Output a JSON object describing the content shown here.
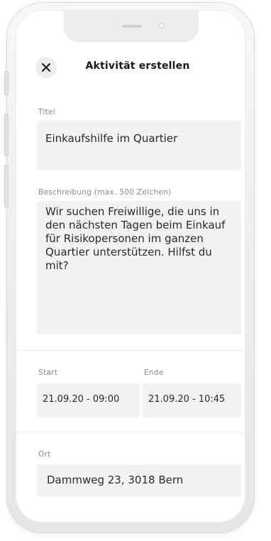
{
  "header": {
    "title": "Aktivität erstellen"
  },
  "form": {
    "title_label": "Titel",
    "title_value": "Einkaufshilfe im Quartier",
    "description_label": "Beschreibung (max. 500 Zeichen)",
    "description_value": "Wir suchen Freiwillige, die uns in den nächsten Tagen beim Einkauf für Risikopersonen im ganzen Quartier unterstützen. Hilfst du mit?",
    "start_label": "Start",
    "start_value": "21.09.20 - 09:00",
    "end_label": "Ende",
    "end_value": "21.09.20 - 10:45",
    "place_label": "Ort",
    "place_value": "Dammweg 23, 3018 Bern"
  },
  "icons": {
    "close": "close-icon"
  },
  "colors": {
    "field_background": "#f2f2f2",
    "label": "#8a8a8a",
    "text": "#2a2a2a"
  }
}
